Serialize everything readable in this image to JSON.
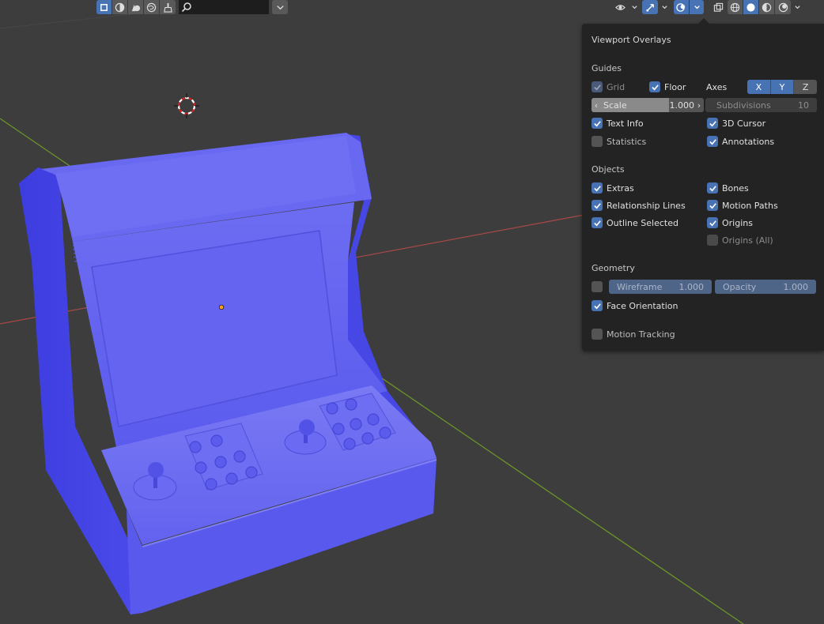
{
  "header": {
    "search": {
      "value": ""
    }
  },
  "overlays": {
    "title": "Viewport Overlays",
    "guides": {
      "heading": "Guides",
      "grid": {
        "label": "Grid",
        "checked": true
      },
      "floor": {
        "label": "Floor",
        "checked": true
      },
      "axes": {
        "label": "Axes",
        "x": "X",
        "y": "Y",
        "z": "Z"
      },
      "scale": {
        "label": "Scale",
        "value": "1.000"
      },
      "subdivisions": {
        "label": "Subdivisions",
        "value": "10"
      },
      "text_info": {
        "label": "Text Info",
        "checked": true
      },
      "cursor_3d": {
        "label": "3D Cursor",
        "checked": true
      },
      "statistics": {
        "label": "Statistics",
        "checked": false
      },
      "annotations": {
        "label": "Annotations",
        "checked": true
      }
    },
    "objects": {
      "heading": "Objects",
      "extras": {
        "label": "Extras",
        "checked": true
      },
      "bones": {
        "label": "Bones",
        "checked": true
      },
      "relationship_lines": {
        "label": "Relationship Lines",
        "checked": true
      },
      "motion_paths": {
        "label": "Motion Paths",
        "checked": true
      },
      "outline_selected": {
        "label": "Outline Selected",
        "checked": true
      },
      "origins": {
        "label": "Origins",
        "checked": true
      },
      "origins_all": {
        "label": "Origins (All)",
        "checked": false
      }
    },
    "geometry": {
      "heading": "Geometry",
      "wireframe": {
        "label": "Wireframe",
        "value": "1.000",
        "checked": false
      },
      "opacity": {
        "label": "Opacity",
        "value": "1.000"
      },
      "face_orientation": {
        "label": "Face Orientation",
        "checked": true
      }
    },
    "motion_tracking": {
      "label": "Motion Tracking",
      "checked": false
    }
  },
  "colors": {
    "background": "#3d3d3d",
    "panel": "#232323",
    "accent": "#4772b3",
    "model": "#5a5aee",
    "x_axis": "#a84848",
    "y_axis": "#6b9428"
  }
}
